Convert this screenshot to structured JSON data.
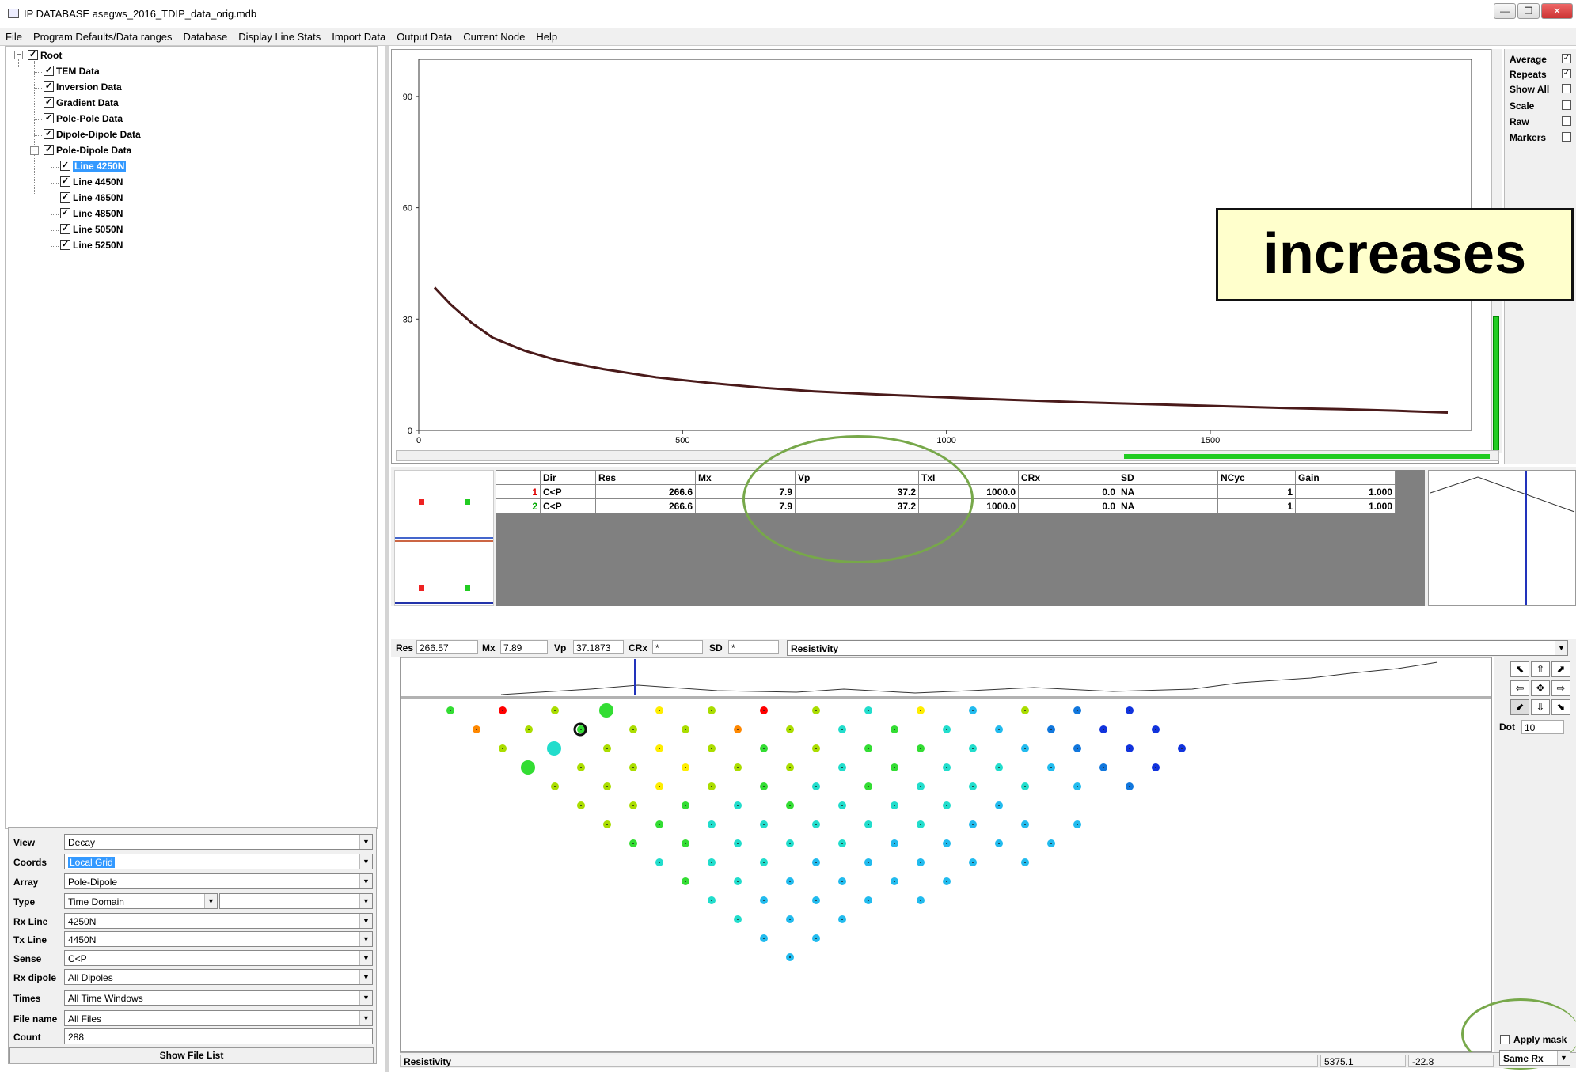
{
  "window": {
    "title": "IP DATABASE asegws_2016_TDIP_data_orig.mdb",
    "controls": [
      "—",
      "❐",
      "✕"
    ]
  },
  "menu": [
    "File",
    "Program Defaults/Data ranges",
    "Database",
    "Display Line Stats",
    "Import Data",
    "Output Data",
    "Current Node",
    "Help"
  ],
  "tree": {
    "root": "Root",
    "items": [
      "TEM Data",
      "Inversion Data",
      "Gradient Data",
      "Pole-Pole Data",
      "Dipole-Dipole Data",
      "Pole-Dipole Data"
    ],
    "lines": [
      "Line 4250N",
      "Line 4450N",
      "Line 4650N",
      "Line 4850N",
      "Line 5050N",
      "Line 5250N"
    ],
    "selected": "Line 4250N"
  },
  "form": {
    "view_label": "View",
    "view": "Decay",
    "coords_label": "Coords",
    "coords": "Local Grid",
    "array_label": "Array",
    "array": "Pole-Dipole",
    "type_label": "Type",
    "type": "Time Domain",
    "type2": "",
    "rxline_label": "Rx Line",
    "rxline": "4250N",
    "txline_label": "Tx Line",
    "txline": "4450N",
    "sense_label": "Sense",
    "sense": "C<P",
    "rxdipole_label": "Rx dipole",
    "rxdipole": "All Dipoles",
    "times_label": "Times",
    "times": "All Time Windows",
    "filename_label": "File name",
    "filename": "All Files",
    "count_label": "Count",
    "count": "288",
    "show_file_list": "Show File List"
  },
  "options": [
    {
      "label": "Average",
      "checked": true
    },
    {
      "label": "Repeats",
      "checked": true
    },
    {
      "label": "Show All",
      "checked": false
    },
    {
      "label": "Scale",
      "checked": false
    },
    {
      "label": "Raw",
      "checked": false
    },
    {
      "label": "Markers",
      "checked": false
    }
  ],
  "callout": "increases",
  "chart_data": {
    "type": "line",
    "title": "",
    "xlabel": "",
    "ylabel": "",
    "xlim": [
      0,
      1995
    ],
    "ylim": [
      0,
      100
    ],
    "xticks": [
      "0",
      "500",
      "1000",
      "1500"
    ],
    "yticks": [
      "0",
      "30",
      "60",
      "90"
    ],
    "series": [
      {
        "color": "#4a1a1a",
        "x": [
          30,
          60,
          100,
          140,
          200,
          260,
          350,
          450,
          550,
          650,
          750,
          850,
          950,
          1050,
          1150,
          1250,
          1350,
          1450,
          1550,
          1650,
          1750,
          1850,
          1950
        ],
        "y": [
          38.5,
          34,
          29,
          25,
          21.5,
          19,
          16.5,
          14.3,
          12.8,
          11.5,
          10.5,
          9.8,
          9.2,
          8.6,
          8.1,
          7.6,
          7.2,
          6.8,
          6.4,
          6.0,
          5.7,
          5.3,
          4.8
        ]
      }
    ]
  },
  "table": {
    "headers": [
      "",
      "Dir",
      "Res",
      "Mx",
      "Vp",
      "TxI",
      "CRx",
      "SD",
      "NCyc",
      "Gain"
    ],
    "rows": [
      [
        "1",
        "C<P",
        "266.6",
        "7.9",
        "37.2",
        "1000.0",
        "0.0",
        "NA",
        "1",
        "1.000"
      ],
      [
        "2",
        "C<P",
        "266.6",
        "7.9",
        "37.2",
        "1000.0",
        "0.0",
        "NA",
        "1",
        "1.000"
      ]
    ]
  },
  "resbar": {
    "res_label": "Res",
    "res": "266.57",
    "mx_label": "Mx",
    "mx": "7.89",
    "vp_label": "Vp",
    "vp": "37.1873",
    "crx_label": "CRx",
    "crx": "*",
    "sd_label": "SD",
    "sd": "*",
    "param": "Resistivity"
  },
  "pseudosection": {
    "legend_colors": [
      "#ff0000",
      "#ff8800",
      "#ffee00",
      "#aadd00",
      "#33dd33",
      "#22ddcc",
      "#22bbee",
      "#1177dd",
      "#1133dd"
    ],
    "dot_label": "Dot",
    "dot": "10",
    "apply_mask": "Apply mask",
    "same_rx": "Same Rx"
  },
  "status": {
    "left": "Resistivity",
    "x": "5375.1",
    "y": "-22.8"
  }
}
